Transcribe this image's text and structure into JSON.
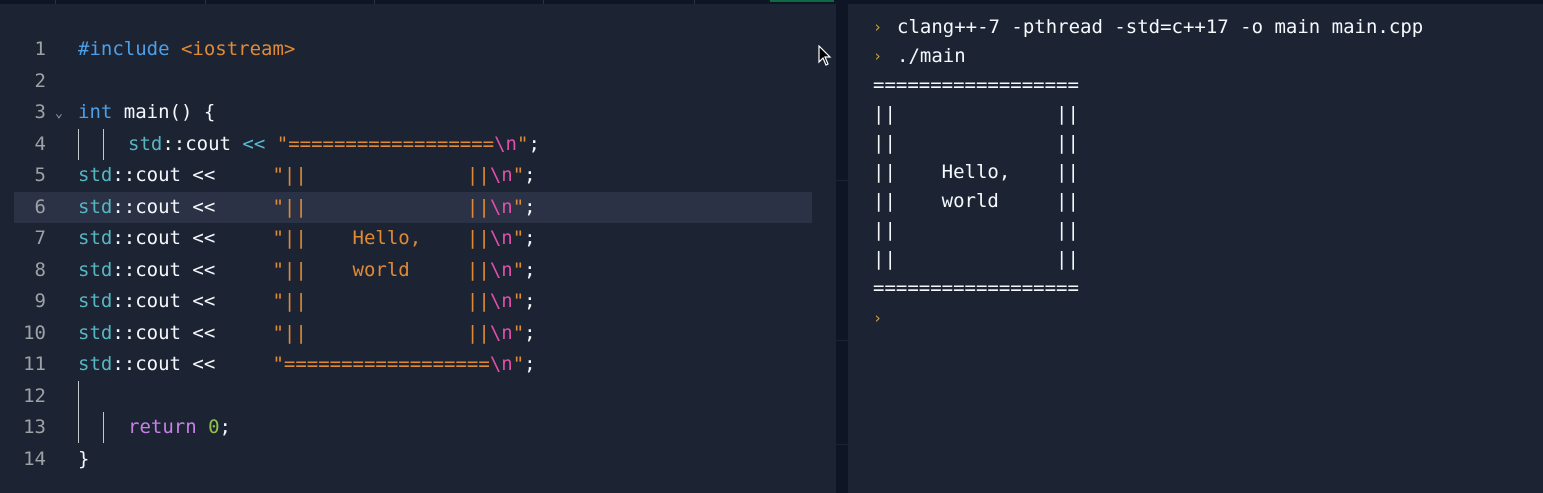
{
  "editor": {
    "lines": [
      {
        "n": "1",
        "tokens": [
          {
            "t": "#include",
            "c": "pp"
          },
          {
            "t": " ",
            "c": "plain"
          },
          {
            "t": "<iostream>",
            "c": "inc"
          }
        ]
      },
      {
        "n": "2",
        "tokens": []
      },
      {
        "n": "3",
        "tokens": [
          {
            "t": "int",
            "c": "kw"
          },
          {
            "t": " main() {",
            "c": "plain"
          }
        ]
      },
      {
        "n": "4",
        "tokens": [
          {
            "t": "std",
            "c": "ns"
          },
          {
            "t": "::cout ",
            "c": "plain"
          },
          {
            "t": "<<",
            "c": "op"
          },
          {
            "t": " \"",
            "c": "str"
          },
          {
            "t": "==================",
            "c": "str"
          },
          {
            "t": "\\n",
            "c": "esc"
          },
          {
            "t": "\"",
            "c": "str"
          },
          {
            "t": ";",
            "c": "plain"
          }
        ]
      },
      {
        "n": "5",
        "tokens": [
          {
            "t": "std",
            "c": "ns"
          },
          {
            "t": "::cout << ",
            "c": "plain"
          },
          {
            "t": "    \"||              ||",
            "c": "str"
          },
          {
            "t": "\\n",
            "c": "esc"
          },
          {
            "t": "\"",
            "c": "str"
          },
          {
            "t": ";",
            "c": "plain"
          }
        ]
      },
      {
        "n": "6",
        "tokens": [
          {
            "t": "std",
            "c": "ns"
          },
          {
            "t": "::cout << ",
            "c": "plain"
          },
          {
            "t": "    \"||              ||",
            "c": "str"
          },
          {
            "t": "\\n",
            "c": "esc"
          },
          {
            "t": "\"",
            "c": "str"
          },
          {
            "t": ";",
            "c": "plain"
          }
        ]
      },
      {
        "n": "7",
        "tokens": [
          {
            "t": "std",
            "c": "ns"
          },
          {
            "t": "::cout << ",
            "c": "plain"
          },
          {
            "t": "    \"||    Hello,    ||",
            "c": "str"
          },
          {
            "t": "\\n",
            "c": "esc"
          },
          {
            "t": "\"",
            "c": "str"
          },
          {
            "t": ";",
            "c": "plain"
          }
        ]
      },
      {
        "n": "8",
        "tokens": [
          {
            "t": "std",
            "c": "ns"
          },
          {
            "t": "::cout << ",
            "c": "plain"
          },
          {
            "t": "    \"||    world     ||",
            "c": "str"
          },
          {
            "t": "\\n",
            "c": "esc"
          },
          {
            "t": "\"",
            "c": "str"
          },
          {
            "t": ";",
            "c": "plain"
          }
        ]
      },
      {
        "n": "9",
        "tokens": [
          {
            "t": "std",
            "c": "ns"
          },
          {
            "t": "::cout << ",
            "c": "plain"
          },
          {
            "t": "    \"||              ||",
            "c": "str"
          },
          {
            "t": "\\n",
            "c": "esc"
          },
          {
            "t": "\"",
            "c": "str"
          },
          {
            "t": ";",
            "c": "plain"
          }
        ]
      },
      {
        "n": "10",
        "tokens": [
          {
            "t": "std",
            "c": "ns"
          },
          {
            "t": "::cout << ",
            "c": "plain"
          },
          {
            "t": "    \"||              ||",
            "c": "str"
          },
          {
            "t": "\\n",
            "c": "esc"
          },
          {
            "t": "\"",
            "c": "str"
          },
          {
            "t": ";",
            "c": "plain"
          }
        ]
      },
      {
        "n": "11",
        "tokens": [
          {
            "t": "std",
            "c": "ns"
          },
          {
            "t": "::cout << ",
            "c": "plain"
          },
          {
            "t": "    \"==================",
            "c": "str"
          },
          {
            "t": "\\n",
            "c": "esc"
          },
          {
            "t": "\"",
            "c": "str"
          },
          {
            "t": ";",
            "c": "plain"
          }
        ]
      },
      {
        "n": "12",
        "tokens": []
      },
      {
        "n": "13",
        "tokens": [
          {
            "t": "return",
            "c": "kwr"
          },
          {
            "t": " ",
            "c": "plain"
          },
          {
            "t": "0",
            "c": "num"
          },
          {
            "t": ";",
            "c": "plain"
          }
        ]
      },
      {
        "n": "14",
        "tokens": [
          {
            "t": "}",
            "c": "plain"
          }
        ]
      }
    ]
  },
  "console": {
    "commands": [
      "clang++-7 -pthread -std=c++17 -o main main.cpp",
      "./main"
    ],
    "output": [
      "==================",
      "||              ||",
      "||              ||",
      "||    Hello,    ||",
      "||    world     ||",
      "||              ||",
      "||              ||",
      "=================="
    ],
    "prompt_icon": "chevron-prompt-icon"
  },
  "colors": {
    "background": "#1c2333",
    "panel_border": "#0e1525",
    "string": "#e08a35",
    "keyword": "#4d9fe6",
    "escape": "#e04fa8",
    "prompt": "#c8a13d"
  }
}
